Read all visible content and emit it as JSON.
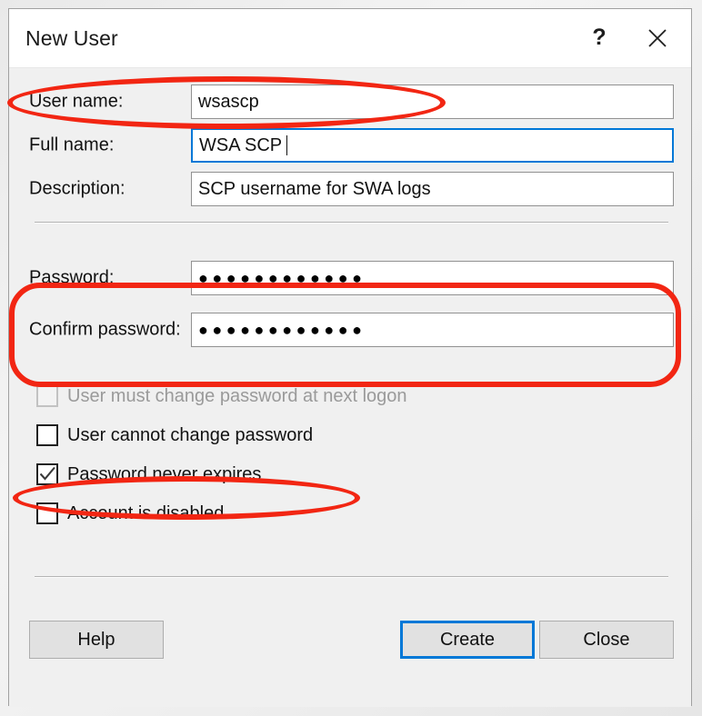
{
  "window": {
    "title": "New User",
    "help_icon": "question-mark-icon",
    "close_icon": "close-icon"
  },
  "fields": [
    {
      "label": "User name:",
      "value": "wsascp",
      "focused": false,
      "masked": false
    },
    {
      "label": "Full name:",
      "value": "WSA SCP ",
      "focused": true,
      "masked": false
    },
    {
      "label": "Description:",
      "value": "SCP username for SWA logs",
      "focused": false,
      "masked": false
    },
    {
      "label": "Password:",
      "value": "●●●●●●●●●●●●",
      "focused": false,
      "masked": true
    },
    {
      "label": "Confirm password:",
      "value": "●●●●●●●●●●●●",
      "focused": false,
      "masked": true
    }
  ],
  "checkboxes": [
    {
      "label": "User must change password at next logon",
      "checked": false,
      "disabled": true
    },
    {
      "label": "User cannot change password",
      "checked": false,
      "disabled": false
    },
    {
      "label": "Password never expires",
      "checked": true,
      "disabled": false
    },
    {
      "label": "Account is disabled",
      "checked": false,
      "disabled": false
    }
  ],
  "buttons": {
    "help": "Help",
    "create": "Create",
    "close": "Close"
  },
  "annotations": {
    "color": "#f22613",
    "items": [
      {
        "name": "username-highlight",
        "shape": "ellipse"
      },
      {
        "name": "password-highlight",
        "shape": "roundrect"
      },
      {
        "name": "never-expires-highlight",
        "shape": "ellipse"
      }
    ]
  }
}
